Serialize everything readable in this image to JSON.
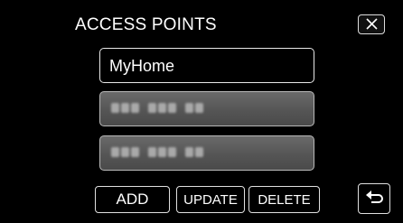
{
  "title": "ACCESS POINTS",
  "access_points": [
    {
      "label": "MyHome",
      "selected": true
    },
    {
      "label": "",
      "obscured": true
    },
    {
      "label": "",
      "obscured": true
    }
  ],
  "buttons": {
    "add": "ADD",
    "update": "UPDATE",
    "delete": "DELETE"
  },
  "icons": {
    "close": "close-icon",
    "back": "return-arrow-icon"
  }
}
